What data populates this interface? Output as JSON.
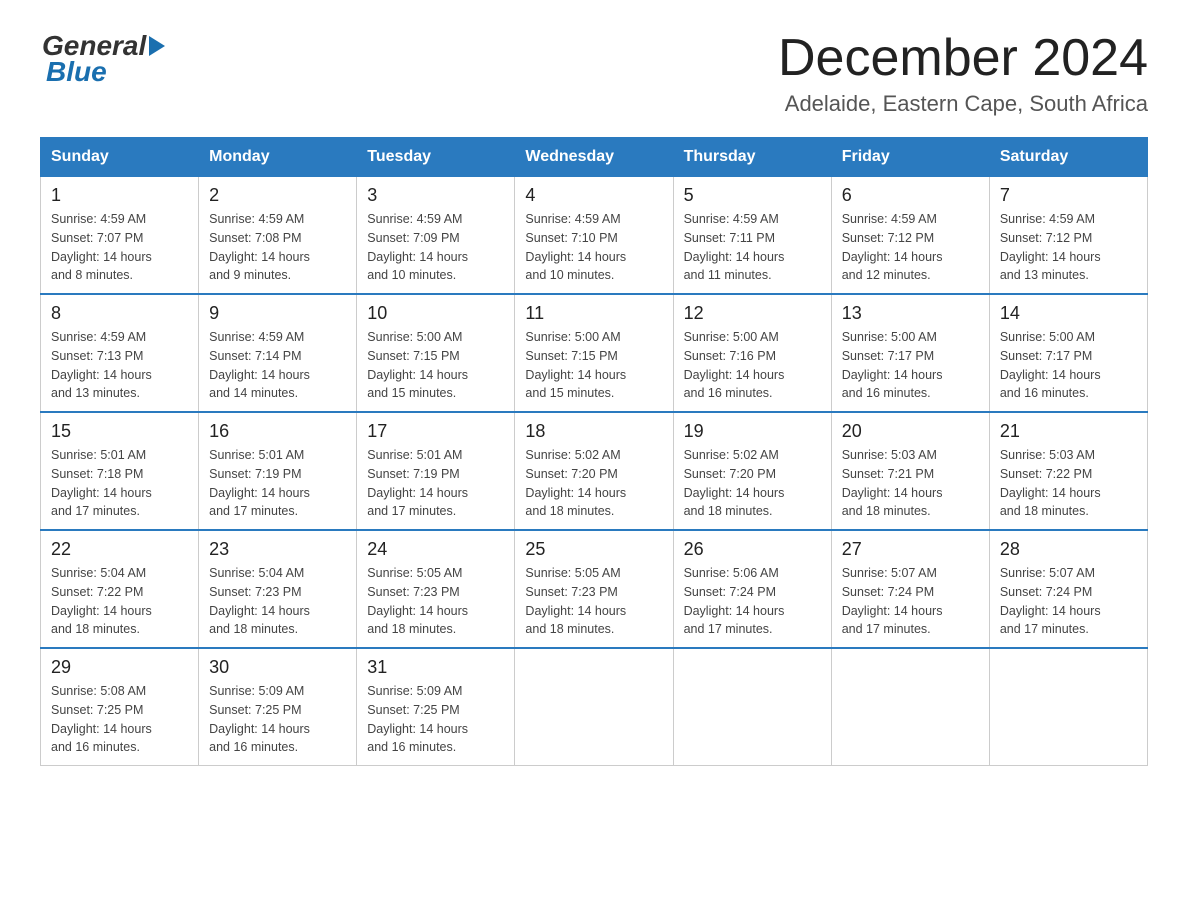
{
  "logo": {
    "general": "General",
    "blue": "Blue"
  },
  "title": "December 2024",
  "subtitle": "Adelaide, Eastern Cape, South Africa",
  "weekdays": [
    "Sunday",
    "Monday",
    "Tuesday",
    "Wednesday",
    "Thursday",
    "Friday",
    "Saturday"
  ],
  "weeks": [
    [
      {
        "day": "1",
        "info": "Sunrise: 4:59 AM\nSunset: 7:07 PM\nDaylight: 14 hours\nand 8 minutes."
      },
      {
        "day": "2",
        "info": "Sunrise: 4:59 AM\nSunset: 7:08 PM\nDaylight: 14 hours\nand 9 minutes."
      },
      {
        "day": "3",
        "info": "Sunrise: 4:59 AM\nSunset: 7:09 PM\nDaylight: 14 hours\nand 10 minutes."
      },
      {
        "day": "4",
        "info": "Sunrise: 4:59 AM\nSunset: 7:10 PM\nDaylight: 14 hours\nand 10 minutes."
      },
      {
        "day": "5",
        "info": "Sunrise: 4:59 AM\nSunset: 7:11 PM\nDaylight: 14 hours\nand 11 minutes."
      },
      {
        "day": "6",
        "info": "Sunrise: 4:59 AM\nSunset: 7:12 PM\nDaylight: 14 hours\nand 12 minutes."
      },
      {
        "day": "7",
        "info": "Sunrise: 4:59 AM\nSunset: 7:12 PM\nDaylight: 14 hours\nand 13 minutes."
      }
    ],
    [
      {
        "day": "8",
        "info": "Sunrise: 4:59 AM\nSunset: 7:13 PM\nDaylight: 14 hours\nand 13 minutes."
      },
      {
        "day": "9",
        "info": "Sunrise: 4:59 AM\nSunset: 7:14 PM\nDaylight: 14 hours\nand 14 minutes."
      },
      {
        "day": "10",
        "info": "Sunrise: 5:00 AM\nSunset: 7:15 PM\nDaylight: 14 hours\nand 15 minutes."
      },
      {
        "day": "11",
        "info": "Sunrise: 5:00 AM\nSunset: 7:15 PM\nDaylight: 14 hours\nand 15 minutes."
      },
      {
        "day": "12",
        "info": "Sunrise: 5:00 AM\nSunset: 7:16 PM\nDaylight: 14 hours\nand 16 minutes."
      },
      {
        "day": "13",
        "info": "Sunrise: 5:00 AM\nSunset: 7:17 PM\nDaylight: 14 hours\nand 16 minutes."
      },
      {
        "day": "14",
        "info": "Sunrise: 5:00 AM\nSunset: 7:17 PM\nDaylight: 14 hours\nand 16 minutes."
      }
    ],
    [
      {
        "day": "15",
        "info": "Sunrise: 5:01 AM\nSunset: 7:18 PM\nDaylight: 14 hours\nand 17 minutes."
      },
      {
        "day": "16",
        "info": "Sunrise: 5:01 AM\nSunset: 7:19 PM\nDaylight: 14 hours\nand 17 minutes."
      },
      {
        "day": "17",
        "info": "Sunrise: 5:01 AM\nSunset: 7:19 PM\nDaylight: 14 hours\nand 17 minutes."
      },
      {
        "day": "18",
        "info": "Sunrise: 5:02 AM\nSunset: 7:20 PM\nDaylight: 14 hours\nand 18 minutes."
      },
      {
        "day": "19",
        "info": "Sunrise: 5:02 AM\nSunset: 7:20 PM\nDaylight: 14 hours\nand 18 minutes."
      },
      {
        "day": "20",
        "info": "Sunrise: 5:03 AM\nSunset: 7:21 PM\nDaylight: 14 hours\nand 18 minutes."
      },
      {
        "day": "21",
        "info": "Sunrise: 5:03 AM\nSunset: 7:22 PM\nDaylight: 14 hours\nand 18 minutes."
      }
    ],
    [
      {
        "day": "22",
        "info": "Sunrise: 5:04 AM\nSunset: 7:22 PM\nDaylight: 14 hours\nand 18 minutes."
      },
      {
        "day": "23",
        "info": "Sunrise: 5:04 AM\nSunset: 7:23 PM\nDaylight: 14 hours\nand 18 minutes."
      },
      {
        "day": "24",
        "info": "Sunrise: 5:05 AM\nSunset: 7:23 PM\nDaylight: 14 hours\nand 18 minutes."
      },
      {
        "day": "25",
        "info": "Sunrise: 5:05 AM\nSunset: 7:23 PM\nDaylight: 14 hours\nand 18 minutes."
      },
      {
        "day": "26",
        "info": "Sunrise: 5:06 AM\nSunset: 7:24 PM\nDaylight: 14 hours\nand 17 minutes."
      },
      {
        "day": "27",
        "info": "Sunrise: 5:07 AM\nSunset: 7:24 PM\nDaylight: 14 hours\nand 17 minutes."
      },
      {
        "day": "28",
        "info": "Sunrise: 5:07 AM\nSunset: 7:24 PM\nDaylight: 14 hours\nand 17 minutes."
      }
    ],
    [
      {
        "day": "29",
        "info": "Sunrise: 5:08 AM\nSunset: 7:25 PM\nDaylight: 14 hours\nand 16 minutes."
      },
      {
        "day": "30",
        "info": "Sunrise: 5:09 AM\nSunset: 7:25 PM\nDaylight: 14 hours\nand 16 minutes."
      },
      {
        "day": "31",
        "info": "Sunrise: 5:09 AM\nSunset: 7:25 PM\nDaylight: 14 hours\nand 16 minutes."
      },
      {
        "day": "",
        "info": ""
      },
      {
        "day": "",
        "info": ""
      },
      {
        "day": "",
        "info": ""
      },
      {
        "day": "",
        "info": ""
      }
    ]
  ]
}
